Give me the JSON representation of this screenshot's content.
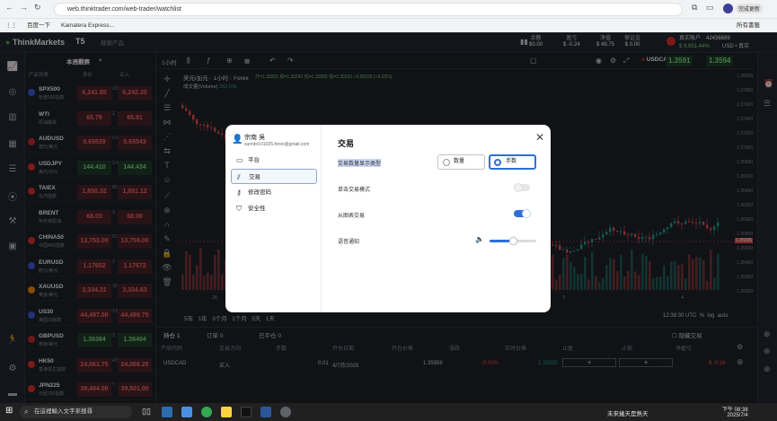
{
  "browser": {
    "url": "web.thinktrader.com/web-trader/watchlist",
    "bookmarks": [
      "百度一下",
      "Kamatera Express..."
    ],
    "all_bookmarks": "所有書籤",
    "profile_btn": "完成更新"
  },
  "app": {
    "logo": "ThinkMarkets",
    "search_placeholder": "搜索产品",
    "header_stats": [
      {
        "label": "余额",
        "value": "$0.00"
      },
      {
        "label": "盈亏",
        "value": "$ -0.24"
      },
      {
        "label": "净值",
        "value": "$ 49.75"
      },
      {
        "label": "保证金",
        "value": "$ 0.00"
      }
    ],
    "free_margin_label": "可用保证金",
    "free_margin_value": "$ 9,951.44%",
    "account_label": "真实账户",
    "account_id": "42436689",
    "account_currency": "USD",
    "account_sub": "USD • 真实"
  },
  "watchlist": {
    "title": "本週觀察",
    "columns": [
      "产品列表",
      "卖价",
      "买入"
    ],
    "items": [
      {
        "sym": "SPX500",
        "sub": "标普500指数",
        "bid": "6,241.85",
        "ask": "6,242.20",
        "sp": "3.5",
        "dir": "down",
        "color": "#3b5bdb"
      },
      {
        "sym": "WTI",
        "sub": "原油期货",
        "bid": "65.79",
        "ask": "65.81",
        "sp": "2",
        "dir": "down",
        "color": "#222"
      },
      {
        "sym": "AUDUSD",
        "sub": "澳元/美元",
        "bid": "0.65539",
        "ask": "0.65543",
        "sp": "0.4",
        "dir": "down",
        "color": "#c92a2a"
      },
      {
        "sym": "USDJPY",
        "sub": "美元/日元",
        "bid": "144.410",
        "ask": "144.434",
        "sp": "2.4",
        "dir": "up",
        "color": "#e03131"
      },
      {
        "sym": "TAIEX",
        "sub": "台湾指数",
        "bid": "1,850.32",
        "ask": "1,851.12",
        "sp": "80",
        "dir": "down",
        "color": "#e03131"
      },
      {
        "sym": "BRENT",
        "sub": "布伦特原油",
        "bid": "68.03",
        "ask": "68.06",
        "sp": "3",
        "dir": "down",
        "color": "#222"
      },
      {
        "sym": "CHINA50",
        "sub": "中国A50指数",
        "bid": "13,753.00",
        "ask": "13,759.00",
        "sp": "6.0",
        "dir": "down",
        "color": "#e03131"
      },
      {
        "sym": "EURUSD",
        "sub": "欧元/美元",
        "bid": "1.17652",
        "ask": "1.17672",
        "sp": "2",
        "dir": "down",
        "color": "#3b5bdb"
      },
      {
        "sym": "XAUUSD",
        "sub": "黄金/美元",
        "bid": "3,334.31",
        "ask": "3,334.63",
        "sp": "32",
        "dir": "down",
        "color": "#f08c00"
      },
      {
        "sym": "US30",
        "sub": "美国30指数",
        "bid": "44,497.00",
        "ask": "44,499.75",
        "sp": "2.8",
        "dir": "down",
        "color": "#3b5bdb"
      },
      {
        "sym": "GBPUSD",
        "sub": "英镑/美元",
        "bid": "1.36384",
        "ask": "1.36404",
        "sp": "2",
        "dir": "up",
        "color": "#c92a2a"
      },
      {
        "sym": "HK50",
        "sub": "香港恒生指数",
        "bid": "24,061.75",
        "ask": "24,066.25",
        "sp": "4.5",
        "dir": "down",
        "color": "#e03131"
      },
      {
        "sym": "JPN225",
        "sub": "日经225指数",
        "bid": "39,494.00",
        "ask": "39,501.00",
        "sp": "7",
        "dir": "down",
        "color": "#e03131"
      }
    ]
  },
  "chart": {
    "timeframe": "1小时",
    "symbol_title": "美元/加元 · 1小时 · Forex",
    "ohlc": "开=1.35895 高=1.35942 低=1.35885 收=1.35935 +0.00039 (+0.03%)",
    "volume": "成交量(Volume)",
    "volume_value": "353.60k",
    "pair": "USDCAD",
    "sell_price": "1.3591",
    "buy_price": "1.3594",
    "price_tag": "1.35935",
    "ranges": [
      "5年",
      "1年",
      "3个月",
      "1个月",
      "5天",
      "1天"
    ],
    "time": "12:38:30",
    "tz": "UTC",
    "log": "log",
    "auto": "auto",
    "xlabels": [
      "26",
      "7月",
      "2",
      "3",
      "4"
    ],
    "yticks": [
      "1.38000",
      "1.37800",
      "1.37600",
      "1.37400",
      "1.37200",
      "1.37000",
      "1.36800",
      "1.36600",
      "1.36400",
      "1.36200",
      "1.36000",
      "1.35800",
      "1.35600",
      "1.35400",
      "1.35200",
      "1.35000"
    ]
  },
  "bottom": {
    "tabs": [
      "持仓",
      "订单",
      "已平仓"
    ],
    "tab_counts": [
      "1",
      "0",
      "0"
    ],
    "hide_label": "隐藏交易",
    "columns": [
      "产品代码",
      "交易方向",
      "手数",
      "开仓日期",
      "开仓价格",
      "涨跌",
      "实时价格",
      "止盈",
      "止损",
      "净盈亏"
    ],
    "row": {
      "symbol": "USDCAD",
      "side": "买入",
      "lots": "0.01",
      "date": "4/7月/2025",
      "open": "1.35958",
      "change": "-0.02%",
      "live": "1.35925",
      "tp": "+",
      "sl": "+",
      "pnl": "$ -0.26"
    }
  },
  "modal": {
    "user_name": "宗南 吳",
    "user_email": "sunnbr101025.forex@gmail.com",
    "nav": [
      "平台",
      "交易",
      "修改密码",
      "安全性"
    ],
    "title": "交易",
    "rows": {
      "display_type_label": "交易数量显示类型",
      "option_units": "数量",
      "option_lots": "手数",
      "one_click_label": "单击交易模式",
      "chart_trading_label": "从图表交易",
      "sound_label": "语音通知"
    },
    "one_click_on": false,
    "chart_trading_on": true,
    "selected_display_type": "手数",
    "volume_level": 0.5
  },
  "taskbar": {
    "search_placeholder": "在這裡輸入文字來搜尋",
    "weather": "未來幾天是熱天",
    "clock_time": "下午 08:38",
    "clock_date": "2025/7/4"
  },
  "colors": {
    "accent": "#2f6fd6",
    "up": "#26a69a",
    "down": "#ef5350",
    "bg": "#1e2228"
  }
}
